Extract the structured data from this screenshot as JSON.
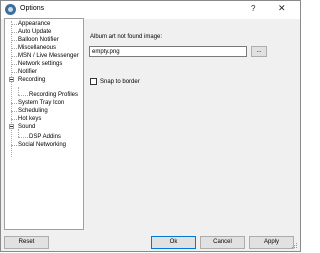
{
  "window": {
    "title": "Options",
    "help_glyph": "?",
    "close_glyph": "✕"
  },
  "tree": {
    "items": [
      {
        "label": "Appearance"
      },
      {
        "label": "Auto Update"
      },
      {
        "label": "Balloon Notifier"
      },
      {
        "label": "Miscellaneous"
      },
      {
        "label": "MSN / Live Messenger"
      },
      {
        "label": "Network settings"
      },
      {
        "label": "Notifier"
      },
      {
        "label": "Recording"
      },
      {
        "label": "Recording Profiles"
      },
      {
        "label": "System Tray Icon"
      },
      {
        "label": "Scheduling"
      },
      {
        "label": "Hot keys"
      },
      {
        "label": "Sound"
      },
      {
        "label": "DSP Addins"
      },
      {
        "label": "Social Networking"
      }
    ]
  },
  "panel": {
    "album_art_label": "Album art not found image:",
    "album_art_value": "empty.png",
    "browse_label": "...",
    "snap_label": "Snap to border",
    "snap_checked": false
  },
  "buttons": {
    "reset": "Reset",
    "ok": "Ok",
    "cancel": "Cancel",
    "apply": "Apply"
  }
}
